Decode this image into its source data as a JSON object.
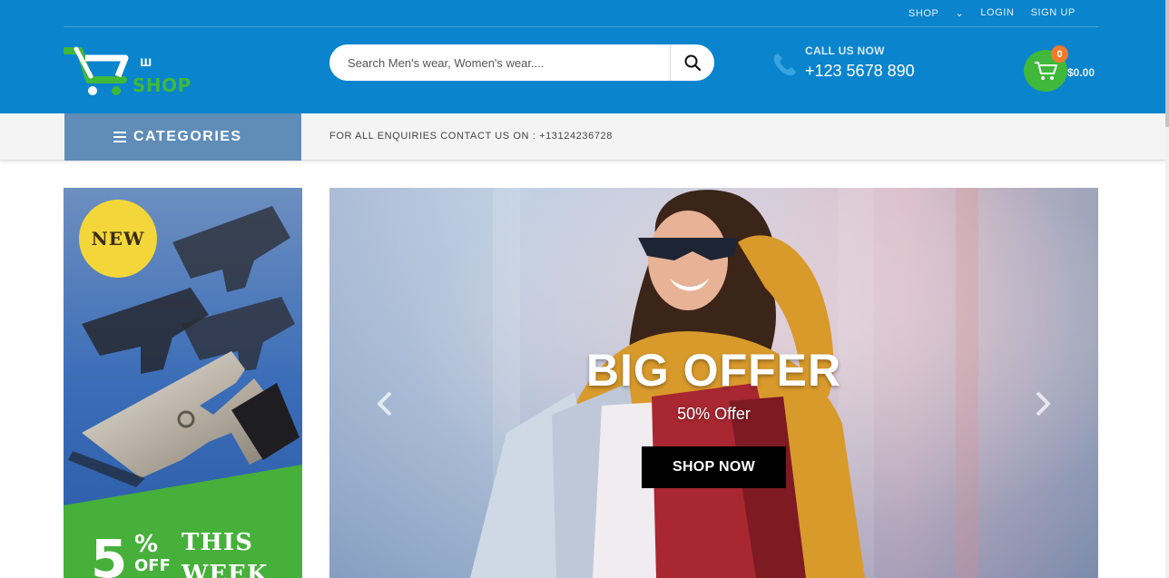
{
  "topnav": {
    "shop": "SHOP",
    "login": "LOGIN",
    "signup": "SIGN UP"
  },
  "logo": {
    "w": "ш",
    "text": "SHOP"
  },
  "search": {
    "placeholder": "Search Men's wear, Women's wear....",
    "button_icon": "search-icon"
  },
  "call": {
    "label": "CALL US NOW",
    "number": "+123 5678 890"
  },
  "cart": {
    "count": "0",
    "total": "$0.00"
  },
  "catbar": {
    "categories_label": "CATEGORIES",
    "enquiry": "FOR ALL ENQUIRIES CONTACT US ON : +13124236728"
  },
  "side_banner": {
    "badge": "NEW",
    "percent": "5",
    "percent_sign": "%",
    "off": "OFF",
    "this": "THIS",
    "week": "WEEK"
  },
  "hero": {
    "title": "BIG OFFER",
    "subtitle": "50% Offer",
    "button": "SHOP NOW"
  },
  "colors": {
    "header_blue": "#0a84cc",
    "accent_green": "#3fb83b",
    "categories_blue": "#5f8db8",
    "badge_orange": "#f07a2c"
  }
}
